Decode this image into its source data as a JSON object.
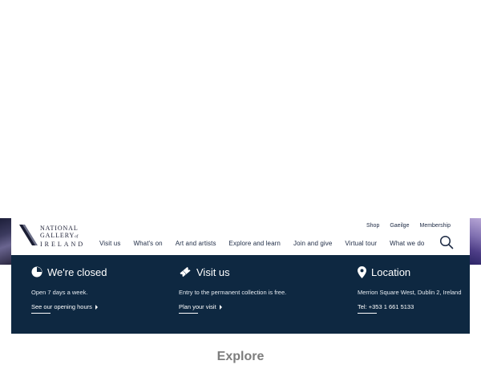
{
  "logo": {
    "line1": "NATIONAL",
    "line2": "GALLERY",
    "line2_of": "of",
    "line3": "IRELAND"
  },
  "util_nav": [
    "Shop",
    "Gaeilge",
    "Membership"
  ],
  "main_nav": [
    "Visit us",
    "What's on",
    "Art and artists",
    "Explore and learn",
    "Join and give",
    "Virtual tour",
    "What we do"
  ],
  "info": {
    "status": {
      "title": "We're closed",
      "text": "Open 7 days a week.",
      "link": "See our opening hours"
    },
    "visit": {
      "title": "Visit us",
      "text": "Entry to the permanent collection is free.",
      "link": "Plan your visit"
    },
    "location": {
      "title": "Location",
      "address": "Merrion Square West, Dublin 2, Ireland",
      "phone": "Tel: +353 1 661 5133"
    }
  },
  "explore": {
    "heading": "Explore"
  },
  "colors": {
    "navy": "#0e2841",
    "text_dark": "#1d2a44",
    "heading_grey": "#7d7d7d"
  }
}
